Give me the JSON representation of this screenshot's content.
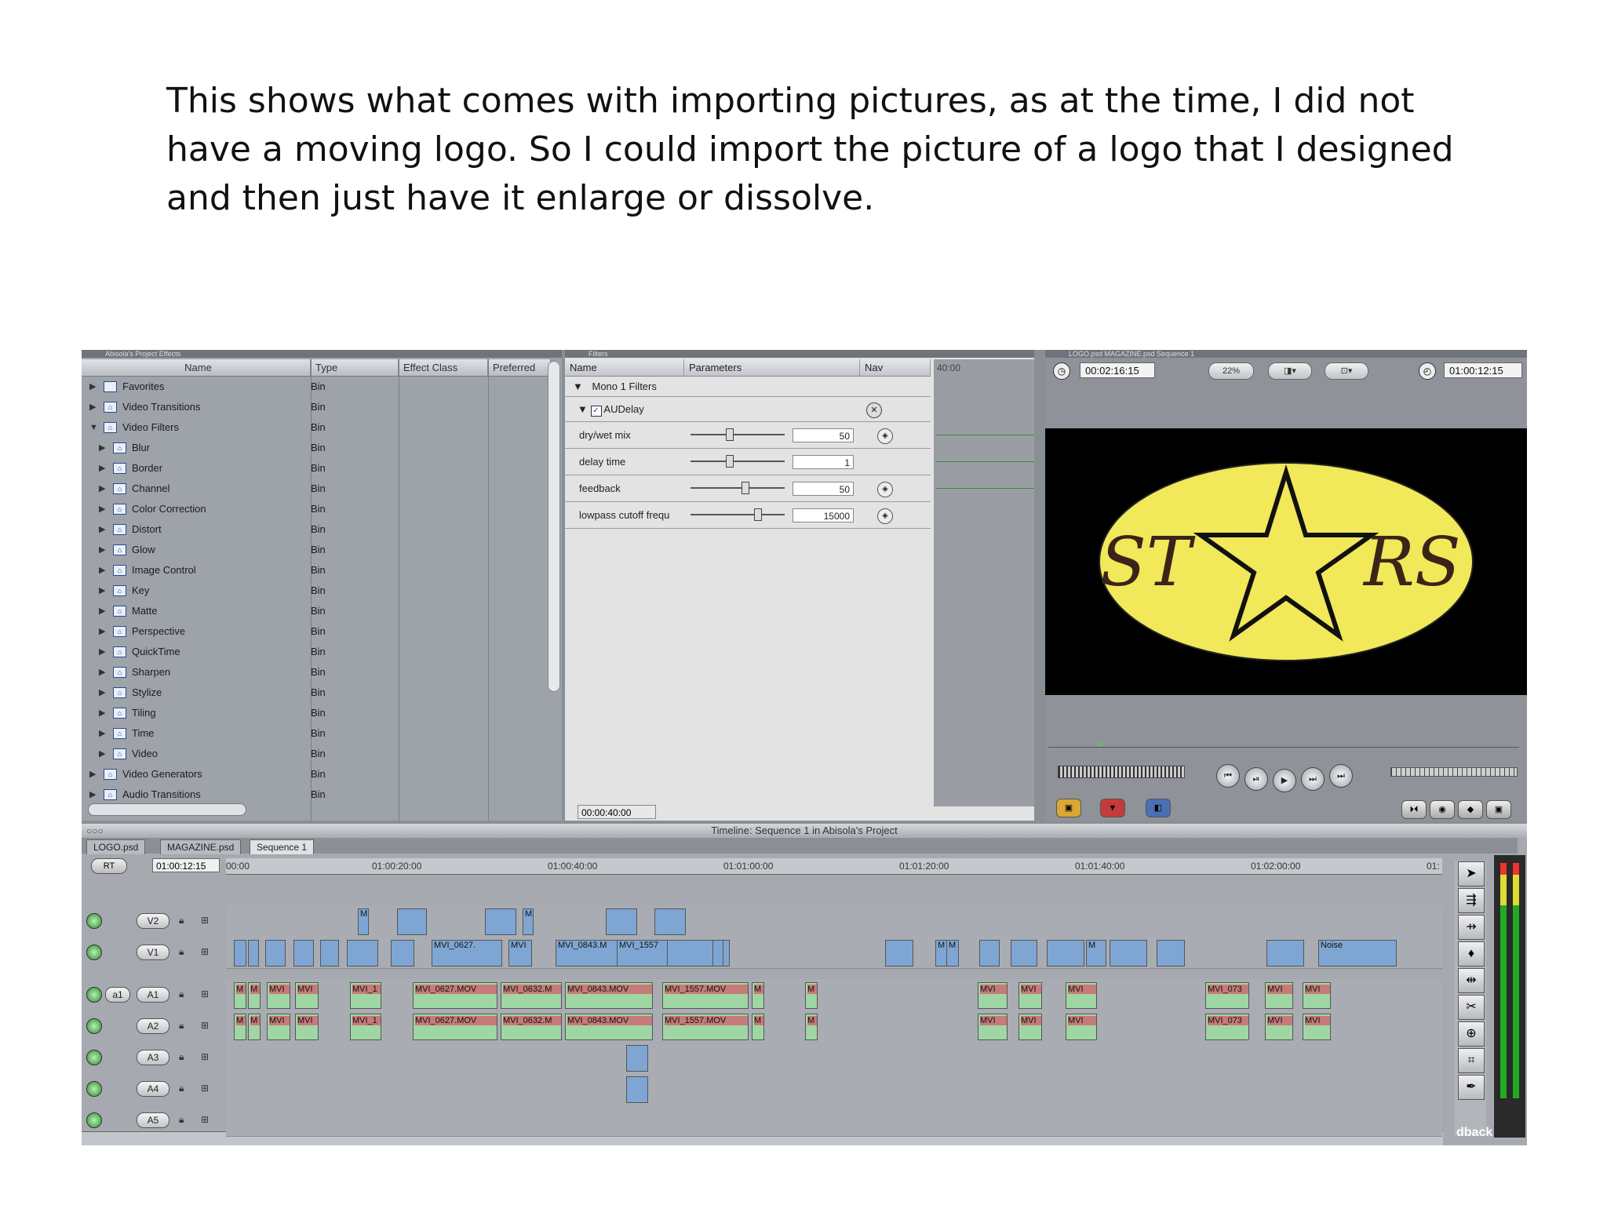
{
  "caption": "This shows what comes with importing pictures, as at the time, I did not have a moving logo. So I could import the picture of a logo that I designed and then just have it enlarge or dissolve.",
  "browser": {
    "tabs": "Abisola's Project  Effects",
    "columns": [
      "Name",
      "Type",
      "Effect Class",
      "Preferred"
    ],
    "items": [
      {
        "label": "Favorites",
        "type": "Bin",
        "indent": 0,
        "expanded": false
      },
      {
        "label": "Video Transitions",
        "type": "Bin",
        "indent": 0,
        "expanded": false
      },
      {
        "label": "Video Filters",
        "type": "Bin",
        "indent": 0,
        "expanded": true
      },
      {
        "label": "Blur",
        "type": "Bin",
        "indent": 1,
        "expanded": false
      },
      {
        "label": "Border",
        "type": "Bin",
        "indent": 1,
        "expanded": false
      },
      {
        "label": "Channel",
        "type": "Bin",
        "indent": 1,
        "expanded": false
      },
      {
        "label": "Color Correction",
        "type": "Bin",
        "indent": 1,
        "expanded": false
      },
      {
        "label": "Distort",
        "type": "Bin",
        "indent": 1,
        "expanded": false
      },
      {
        "label": "Glow",
        "type": "Bin",
        "indent": 1,
        "expanded": false
      },
      {
        "label": "Image Control",
        "type": "Bin",
        "indent": 1,
        "expanded": false
      },
      {
        "label": "Key",
        "type": "Bin",
        "indent": 1,
        "expanded": false
      },
      {
        "label": "Matte",
        "type": "Bin",
        "indent": 1,
        "expanded": false
      },
      {
        "label": "Perspective",
        "type": "Bin",
        "indent": 1,
        "expanded": false
      },
      {
        "label": "QuickTime",
        "type": "Bin",
        "indent": 1,
        "expanded": false
      },
      {
        "label": "Sharpen",
        "type": "Bin",
        "indent": 1,
        "expanded": false
      },
      {
        "label": "Stylize",
        "type": "Bin",
        "indent": 1,
        "expanded": false
      },
      {
        "label": "Tiling",
        "type": "Bin",
        "indent": 1,
        "expanded": false
      },
      {
        "label": "Time",
        "type": "Bin",
        "indent": 1,
        "expanded": false
      },
      {
        "label": "Video",
        "type": "Bin",
        "indent": 1,
        "expanded": false
      },
      {
        "label": "Video Generators",
        "type": "Bin",
        "indent": 0,
        "expanded": false
      },
      {
        "label": "Audio Transitions",
        "type": "Bin",
        "indent": 0,
        "expanded": false
      }
    ]
  },
  "filters": {
    "tab": "Filters",
    "columns": [
      "Name",
      "Parameters",
      "Nav"
    ],
    "kf_time": "40:00",
    "group": "Mono 1 Filters",
    "effect": "AUDelay",
    "params": [
      {
        "name": "dry/wet mix",
        "value": "50",
        "level": 0.4
      },
      {
        "name": "delay time",
        "value": "1",
        "level": 0.4
      },
      {
        "name": "feedback",
        "value": "50",
        "level": 0.58
      },
      {
        "name": "lowpass cutoff frequ",
        "value": "15000",
        "level": 0.72
      }
    ],
    "timecode": "00:00:40:00"
  },
  "viewer": {
    "tabs": "LOGO.psd  MAGAZINE.psd  Sequence 1",
    "duration": "00:02:16:15",
    "zoom": "22%",
    "current": "01:00:12:15",
    "logo_left": "ST",
    "logo_right": "RS",
    "logo_fill": "#f1e85a"
  },
  "timeline": {
    "title": "Timeline: Sequence 1 in Abisola's Project",
    "tabs": [
      "LOGO.psd",
      "MAGAZINE.psd",
      "Sequence 1"
    ],
    "rt": "RT",
    "timecode": "01:00:12:15",
    "ruler": [
      "00:00",
      "01:00:20:00",
      "01:00:40:00",
      "01:01:00:00",
      "01:01:20:00",
      "01:01:40:00",
      "01:02:00:00",
      "01:"
    ],
    "tracks": [
      "V2",
      "V1",
      "A1",
      "A2",
      "A3",
      "A4",
      "A5"
    ],
    "a1_src": "a1",
    "v1_clips": [
      "M",
      "M",
      "MVI_0627.",
      "MVI",
      "MVI_0843.M",
      "MVI_1557",
      "M",
      "M",
      "M",
      "Noise"
    ],
    "v2_clips": [
      "M",
      "M"
    ],
    "a_clips": [
      "M",
      "M",
      "MVI",
      "MVI",
      "MVI_1",
      "MVI_0627.MOV",
      "MVI_0632.M",
      "MVI_0843.MOV",
      "MVI_1557.MOV",
      "M",
      "M",
      "MVI",
      "MVI",
      "MVI",
      "MVI_073",
      "MVI",
      "MVI"
    ],
    "feedback_label": "dback"
  }
}
